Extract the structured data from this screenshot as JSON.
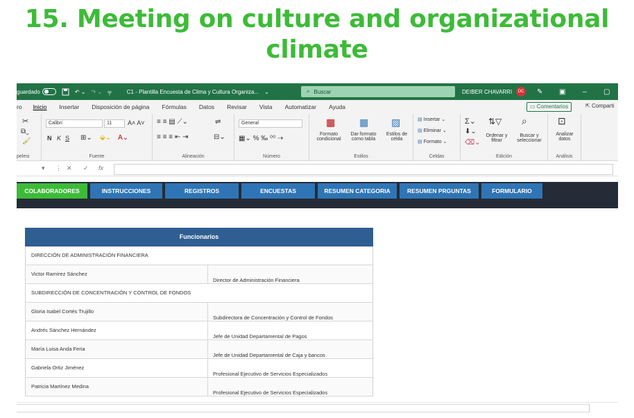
{
  "headline": {
    "line1": "15. Meeting on culture and organizational",
    "line2": "climate"
  },
  "titlebar": {
    "autosave_label": "guardado",
    "file_name": "C1 - Plantilla Encuesta de Clima y Cultura Organiza...",
    "search_label": "Buscar",
    "user_name": "DEIBER CHAVARRI",
    "user_initials": "DC"
  },
  "menu": {
    "tabs": [
      "ro",
      "Inicio",
      "Insertar",
      "Disposición de página",
      "Fórmulas",
      "Datos",
      "Revisar",
      "Vista",
      "Automatizar",
      "Ayuda"
    ],
    "comments_label": "Comentarios",
    "share_label": "Comparti"
  },
  "ribbon": {
    "font_name": "Calibri",
    "font_size": "11",
    "number_format": "General",
    "group_labels": [
      "pelesi",
      "Fuente",
      "Alineación",
      "Número",
      "Estilos",
      "Celdas",
      "Edición",
      "Análisis"
    ],
    "styles": {
      "conditional": "Formato condicional",
      "as_table": "Dar formato como tabla",
      "cell_styles": "Estilos de celda"
    },
    "cells": {
      "insert": "Insertar",
      "delete": "Eliminar",
      "format": "Formato"
    },
    "editing": {
      "sort": "Ordenar y filtrar",
      "find": "Buscar y seleccionar"
    },
    "analysis": {
      "analyze": "Analizar datos"
    }
  },
  "formula_bar": {
    "fx": "fx"
  },
  "nav_tabs": [
    "COLABORADORES",
    "INSTRUCCIONES",
    "REGISTROS",
    "ENCUESTAS",
    "RESUMEN CATEGORIA",
    "RESUMEN PRGUNTAS",
    "FORMULARIO"
  ],
  "colors": {
    "accent_green": "#3dbb38",
    "excel_green": "#217346",
    "nav_active": "#3dbb38",
    "nav_tab": "#2f75b5",
    "table_header": "#2f5e93"
  },
  "table": {
    "header": "Funcionarios",
    "rows": [
      {
        "section": "DIRECCIÓN DE ADMINISTRACIÓN FINANCIERA"
      },
      {
        "name": "Victor Ramírez Sánchez",
        "position": "Director de Administración Financiera"
      },
      {
        "section": "SUBDIRECCIÓN DE CONCENTRACIÓN Y CONTROL DE FONDOS"
      },
      {
        "name": "Gloria Isabel Cortés Trujillo",
        "position": "Subdirectora de Concentración y Control de Fondos"
      },
      {
        "name": "Andrés Sánchez Hernández",
        "position": "Jefe de Unidad Departamental de Pagos"
      },
      {
        "name": "María Luisa Anda Feria",
        "position": "Jefe de Unidad Departamental de Caja y bancos"
      },
      {
        "name": "Gabriela Ortiz Jiménez",
        "position": "Profesional Ejecutivo de Servicios Especializados"
      },
      {
        "name": "Patricia Martínez Medina",
        "position": "Profesional Ejecutivo de Servicios Especializados"
      }
    ]
  }
}
